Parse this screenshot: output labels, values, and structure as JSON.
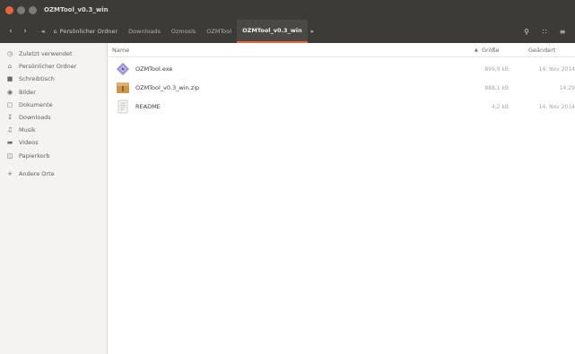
{
  "window": {
    "title": "OZMTool_v0.3_win"
  },
  "toolbar": {
    "back_icon": "chevron-left-icon",
    "forward_icon": "chevron-right-icon",
    "crumb_left_icon": "caret-left-icon",
    "crumbs": [
      {
        "label": "Persönlicher Ordner",
        "icon": "home-icon"
      },
      {
        "label": "Downloads"
      },
      {
        "label": "Ozmosis"
      },
      {
        "label": "OZMTool"
      },
      {
        "label": "OZMTool_v0.3_win"
      }
    ],
    "crumb_more_icon": "caret-right-icon",
    "search_icon": "search-icon",
    "view_icon": "view-options-icon",
    "menu_icon": "hamburger-icon"
  },
  "sidebar": {
    "items": [
      {
        "label": "Zuletzt verwendet",
        "icon": "clock-icon"
      },
      {
        "label": "Persönlicher Ordner",
        "icon": "home-icon"
      },
      {
        "label": "Schreibtisch",
        "icon": "desktop-folder-icon"
      },
      {
        "label": "Bilder",
        "icon": "camera-icon"
      },
      {
        "label": "Dokumente",
        "icon": "document-icon"
      },
      {
        "label": "Downloads",
        "icon": "download-icon"
      },
      {
        "label": "Musik",
        "icon": "music-icon"
      },
      {
        "label": "Videos",
        "icon": "video-icon"
      },
      {
        "label": "Papierkorb",
        "icon": "trash-icon"
      },
      {
        "label": "Andere Orte",
        "icon": "plus-icon"
      }
    ]
  },
  "list": {
    "columns": {
      "name": "Name",
      "size": "Größe",
      "modified": "Geändert"
    },
    "sort_icon": "sort-ascending-icon",
    "files": [
      {
        "name": "OZMTool.exe",
        "size": "899,9 kB",
        "modified": "14. Nov 2014",
        "icon": "executable-icon"
      },
      {
        "name": "OZMTool_v0.3_win.zip",
        "size": "888,1 kB",
        "modified": "14:29",
        "icon": "archive-icon"
      },
      {
        "name": "README",
        "size": "4,2 kB",
        "modified": "14. Nov 2014",
        "icon": "text-file-icon"
      }
    ]
  },
  "colors": {
    "accent": "#e9643c",
    "titlebar": "#3c3b37",
    "sidebar_bg": "#f4f3f1"
  }
}
